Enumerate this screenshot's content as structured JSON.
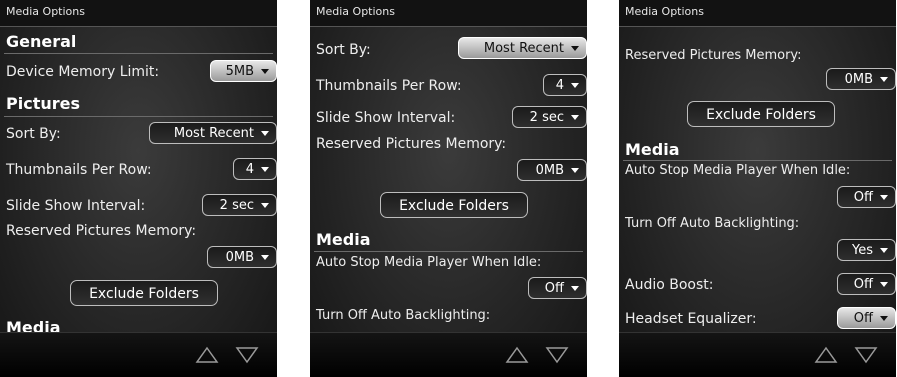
{
  "screens": [
    {
      "title": "Media Options",
      "general_heading": "General",
      "device_memory_label": "Device Memory Limit:",
      "device_memory_value": "5MB",
      "pictures_heading": "Pictures",
      "sort_by_label": "Sort By:",
      "sort_by_value": "Most Recent",
      "thumbnails_label": "Thumbnails Per Row:",
      "thumbnails_value": "4",
      "slideshow_label": "Slide Show Interval:",
      "slideshow_value": "2 sec",
      "reserved_label": "Reserved Pictures Memory:",
      "reserved_value": "0MB",
      "exclude_button": "Exclude Folders",
      "media_heading": "Media"
    },
    {
      "title": "Media Options",
      "sort_by_label": "Sort By:",
      "sort_by_value": "Most Recent",
      "thumbnails_label": "Thumbnails Per Row:",
      "thumbnails_value": "4",
      "slideshow_label": "Slide Show Interval:",
      "slideshow_value": "2 sec",
      "reserved_label": "Reserved Pictures Memory:",
      "reserved_value": "0MB",
      "exclude_button": "Exclude Folders",
      "media_heading": "Media",
      "auto_stop_label": "Auto Stop Media Player When Idle:",
      "auto_stop_value": "Off",
      "backlight_label": "Turn Off Auto Backlighting:"
    },
    {
      "title": "Media Options",
      "reserved_label": "Reserved Pictures Memory:",
      "reserved_value": "0MB",
      "exclude_button": "Exclude Folders",
      "media_heading": "Media",
      "auto_stop_label": "Auto Stop Media Player When Idle:",
      "auto_stop_value": "Off",
      "backlight_label": "Turn Off Auto Backlighting:",
      "backlight_value": "Yes",
      "audio_boost_label": "Audio Boost:",
      "audio_boost_value": "Off",
      "headset_eq_label": "Headset Equalizer:",
      "headset_eq_value": "Off"
    }
  ],
  "icons": {
    "dropdown": "chevron-down-icon",
    "nav_up": "nav-up-icon",
    "nav_down": "nav-down-icon"
  },
  "colors": {
    "background": "#262626",
    "titlebar": "#121212",
    "focus_fill": "#d8d8d8",
    "text": "#f2f2f2"
  }
}
